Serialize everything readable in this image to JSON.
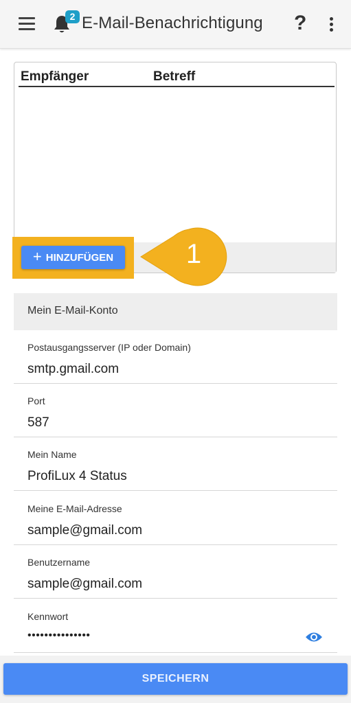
{
  "appbar": {
    "title": "E-Mail-Benachrichtigung",
    "badge_count": "2",
    "help_label": "?",
    "icons": [
      "menu-icon",
      "bell-icon",
      "help-icon",
      "more-vert-icon"
    ]
  },
  "recipients_table": {
    "columns": [
      "Empfänger",
      "Betreff"
    ],
    "rows": [],
    "add_button_label": "HINZUFÜGEN"
  },
  "callout": {
    "number": "1",
    "color": "#f3b11f"
  },
  "account": {
    "section_title": "Mein E-Mail-Konto",
    "fields": [
      {
        "label": "Postausgangsserver (IP oder Domain)",
        "value": "smtp.gmail.com"
      },
      {
        "label": "Port",
        "value": "587"
      },
      {
        "label": "Mein Name",
        "value": "ProfiLux 4 Status"
      },
      {
        "label": "Meine E-Mail-Adresse",
        "value": "sample@gmail.com"
      },
      {
        "label": "Benutzername",
        "value": "sample@gmail.com"
      },
      {
        "label": "Kennwort",
        "value": "•••••••••••••••"
      }
    ]
  },
  "save_button_label": "SPEICHERN",
  "colors": {
    "accent": "#4a8af4",
    "badge": "#1e9fc8",
    "highlight": "#f3b11f",
    "eye_icon": "#2f7fe0"
  }
}
